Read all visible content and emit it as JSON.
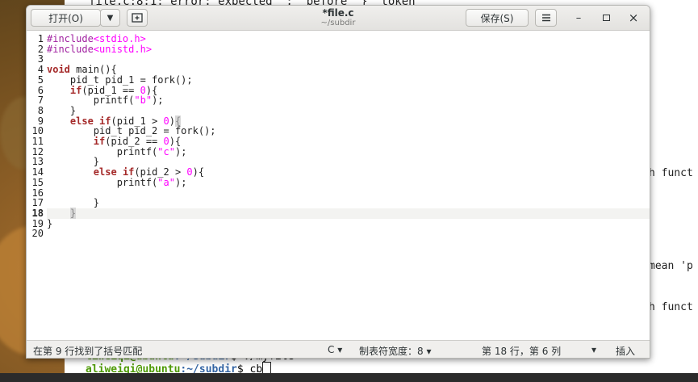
{
  "terminal": {
    "top_text": "file.c:8:1: error: expected ';' before '}' token",
    "right_fragments": [
      "h funct",
      "mean 'p",
      "h funct"
    ],
    "prompt_prev_user": "liweiqi@ubuntu",
    "prompt_prev_path": ":~/subdir",
    "prompt_prev_cmd": "$ ./myfile",
    "prompt_user": "aliweiqi@ubuntu",
    "prompt_path": ":~/subdir",
    "prompt_cmd": "$ cb"
  },
  "gedit": {
    "open_label": "打开(O)",
    "open_menu_icon": "chevron-down-icon",
    "new_tab_icon": "new-document-icon",
    "title": "*file.c",
    "subtitle": "~/subdir",
    "save_label": "保存(S)",
    "menu_icon": "hamburger-icon",
    "minimize_glyph": "–",
    "maximize_glyph": "▫",
    "close_glyph": "×"
  },
  "editor": {
    "line_numbers": [
      "1",
      "2",
      "3",
      "4",
      "5",
      "6",
      "7",
      "8",
      "9",
      "10",
      "11",
      "12",
      "13",
      "14",
      "15",
      "16",
      "17",
      "18",
      "19",
      "20"
    ],
    "current_line": "18",
    "lines": [
      "#include<stdio.h>",
      "#include<unistd.h>",
      "",
      "void main(){",
      "    pid_t pid_1 = fork();",
      "    if(pid_1 == 0){",
      "        printf(\"b\");",
      "    }",
      "    else if(pid_1 > 0){",
      "        pid_t pid_2 = fork();",
      "        if(pid_2 == 0){",
      "            printf(\"c\");",
      "        }",
      "        else if(pid_2 > 0){",
      "            printf(\"a\");",
      "",
      "        }",
      "    }",
      "}",
      ""
    ]
  },
  "statusbar": {
    "message": "在第 9 行找到了括号匹配",
    "language": "C",
    "tab_width": "制表符宽度：8",
    "position": "第 18 行，第 6 列",
    "insert_mode": "插入",
    "dropdown_glyph": "▾"
  }
}
